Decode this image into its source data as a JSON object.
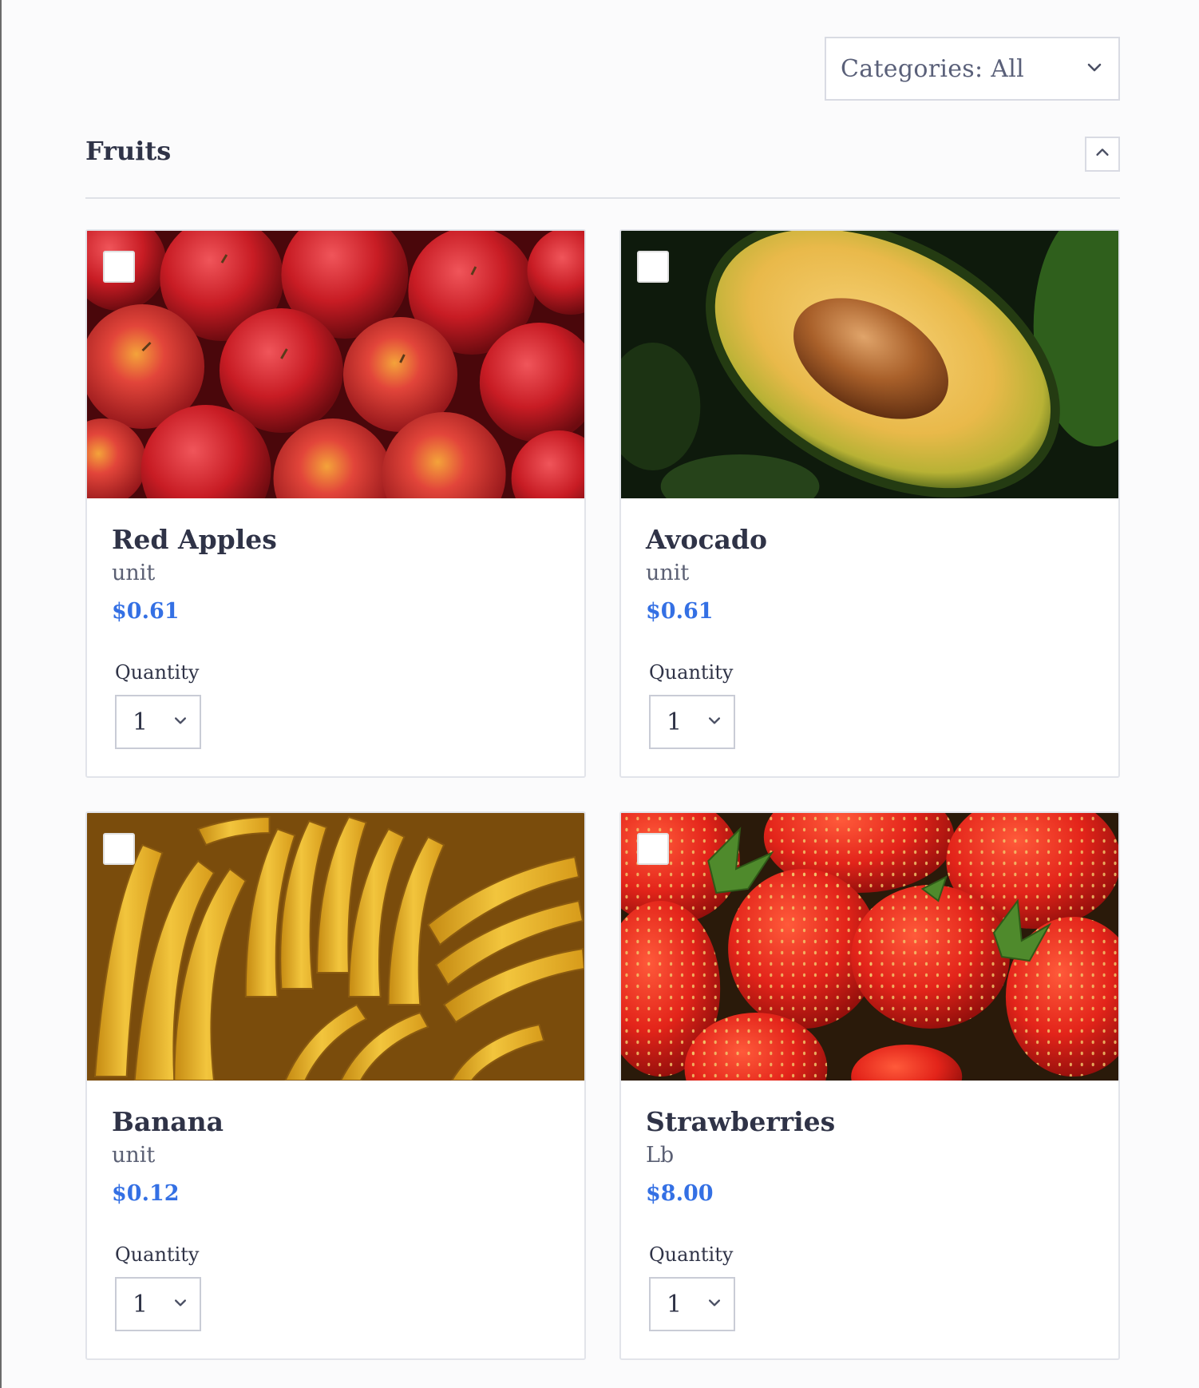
{
  "filter": {
    "label": "Categories: All",
    "icon": "chevron-down-icon"
  },
  "section": {
    "title": "Fruits",
    "collapse_icon": "chevron-up-icon"
  },
  "products": [
    {
      "name": "Red Apples",
      "unit": "unit",
      "price": "$0.61",
      "quantity_label": "Quantity",
      "quantity": "1",
      "image": "red-apples-photo"
    },
    {
      "name": "Avocado",
      "unit": "unit",
      "price": "$0.61",
      "quantity_label": "Quantity",
      "quantity": "1",
      "image": "avocado-photo"
    },
    {
      "name": "Banana",
      "unit": "unit",
      "price": "$0.12",
      "quantity_label": "Quantity",
      "quantity": "1",
      "image": "banana-photo"
    },
    {
      "name": "Strawberries",
      "unit": "Lb",
      "price": "$8.00",
      "quantity_label": "Quantity",
      "quantity": "1",
      "image": "strawberries-photo"
    }
  ],
  "colors": {
    "price": "#3470e4",
    "text": "#2f3347",
    "border": "#e2e4ea"
  }
}
